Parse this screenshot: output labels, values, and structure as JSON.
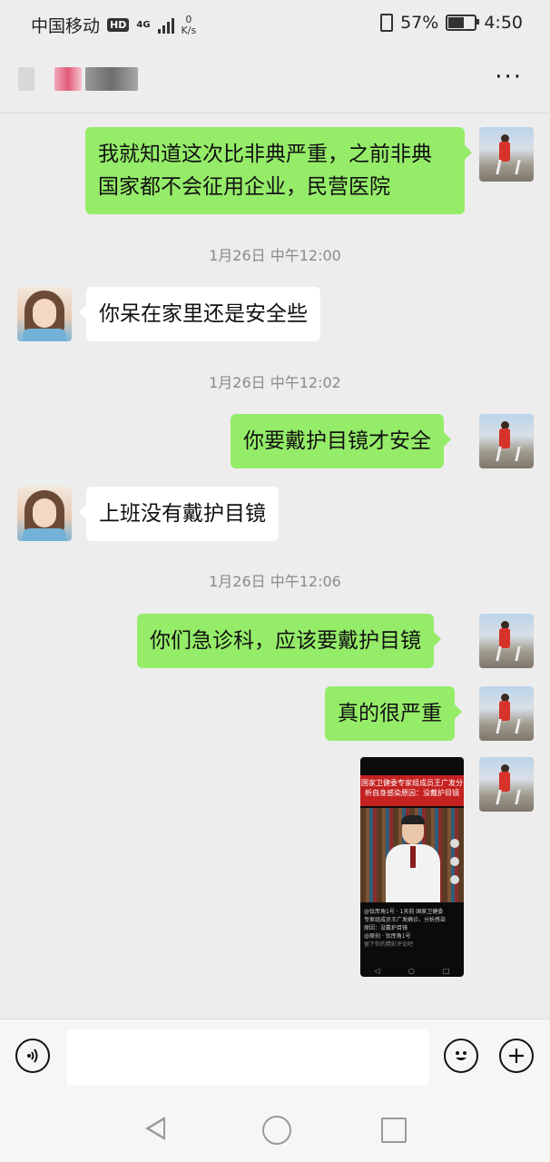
{
  "status_bar": {
    "carrier": "中国移动",
    "hd": "HD",
    "network": "4G",
    "speed_value": "0",
    "speed_unit": "K/s",
    "battery_percent": "57%",
    "battery_level": 0.57,
    "time": "4:50"
  },
  "header": {
    "more_label": "···"
  },
  "messages": [
    {
      "side": "me",
      "text": "我就知道这次比非典严重，之前非典国家都不会征用企业，民营医院"
    },
    {
      "timestamp": "1月26日 中午12:00"
    },
    {
      "side": "other",
      "text": "你呆在家里还是安全些"
    },
    {
      "timestamp": "1月26日 中午12:02"
    },
    {
      "side": "me",
      "text": "你要戴护目镜才安全"
    },
    {
      "side": "other",
      "text": "上班没有戴护目镜"
    },
    {
      "timestamp": "1月26日 中午12:06"
    },
    {
      "side": "me",
      "text": "你们急诊科，应该要戴护目镜"
    },
    {
      "side": "me",
      "text": "真的很严重"
    },
    {
      "side": "me",
      "type": "video"
    }
  ],
  "video": {
    "banner": "国家卫健委专家组成员王广发分析自身感染原因：没戴护目镜",
    "caption": "@钛厍角1号 · 1天前 国家卫健委专家组成员王广发确诊，分析感染原因：没戴护目镜",
    "music": "@原创 · 钛厍角1号",
    "footer": "留下你的精彩评论吧"
  },
  "input_bar": {
    "voice_icon": "voice-icon",
    "emoji_icon": "emoji-icon",
    "plus_icon": "plus-icon"
  },
  "colors": {
    "my_bubble": "#95ec69",
    "other_bubble": "#ffffff",
    "background": "#ededed",
    "video_banner": "#c42120"
  }
}
